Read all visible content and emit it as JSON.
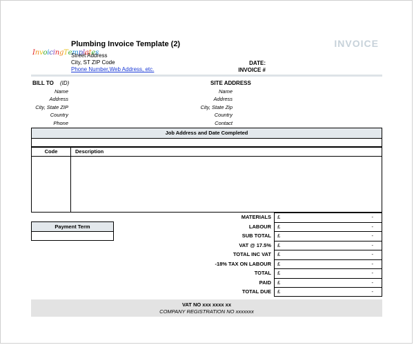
{
  "header": {
    "logo": [
      {
        "text": "I",
        "color": "#e02424"
      },
      {
        "text": "n",
        "color": "#f08a1c"
      },
      {
        "text": "v",
        "color": "#e8c31a"
      },
      {
        "text": "o",
        "color": "#3aa935"
      },
      {
        "text": "i",
        "color": "#1f8fd6"
      },
      {
        "text": "c",
        "color": "#3e4fbf"
      },
      {
        "text": "i",
        "color": "#8a3fb5"
      },
      {
        "text": "n",
        "color": "#e02424"
      },
      {
        "text": "g",
        "color": "#f08a1c"
      },
      {
        "text": "T",
        "color": "#e8c31a"
      },
      {
        "text": "e",
        "color": "#3aa935"
      },
      {
        "text": "m",
        "color": "#1f8fd6"
      },
      {
        "text": "p",
        "color": "#3e4fbf"
      },
      {
        "text": "l",
        "color": "#8a3fb5"
      },
      {
        "text": "a",
        "color": "#e02424"
      },
      {
        "text": "t",
        "color": "#f08a1c"
      },
      {
        "text": "e",
        "color": "#3aa935"
      },
      {
        "text": "s",
        "color": "#1f8fd6"
      }
    ],
    "company_name": "Plumbing Invoice Template (2)",
    "street": "Street Address",
    "city": "City, ST  ZIP Code",
    "phone_web": "Phone Number,Web Address, etc.",
    "title": "INVOICE",
    "date_label": "DATE:",
    "invoice_no_label": "INVOICE #"
  },
  "bill_to": {
    "heading": "BILL TO",
    "id": "(ID)",
    "fields": [
      "Name",
      "Address",
      "City, State ZIP",
      "Country",
      "Phone"
    ]
  },
  "site_address": {
    "heading": "SITE ADDRESS",
    "fields": [
      "Name",
      "Address",
      "City, State Zip",
      "Country",
      "Contact"
    ]
  },
  "job": {
    "heading": "Job Address and Date Completed"
  },
  "items": {
    "code_header": "Code",
    "description_header": "Description"
  },
  "payment": {
    "heading": "Payment Term"
  },
  "totals": {
    "currency": "£",
    "rows": [
      {
        "label": "MATERIALS",
        "value": "-"
      },
      {
        "label": "LABOUR",
        "value": "-"
      },
      {
        "label": "SUB TOTAL",
        "value": "-"
      },
      {
        "label": "VAT @ 17.5%",
        "value": "-"
      },
      {
        "label": "TOTAL INC VAT",
        "value": "-"
      },
      {
        "label": "-18% TAX ON LABOUR",
        "value": "-"
      },
      {
        "label": "TOTAL",
        "value": "-"
      },
      {
        "label": "PAID",
        "value": "-"
      },
      {
        "label": "TOTAL DUE",
        "value": "-"
      }
    ]
  },
  "footer": {
    "vat": "VAT NO  xxx xxxx xx",
    "registration": "COMPANY REGISTRATION NO xxxxxxx"
  }
}
